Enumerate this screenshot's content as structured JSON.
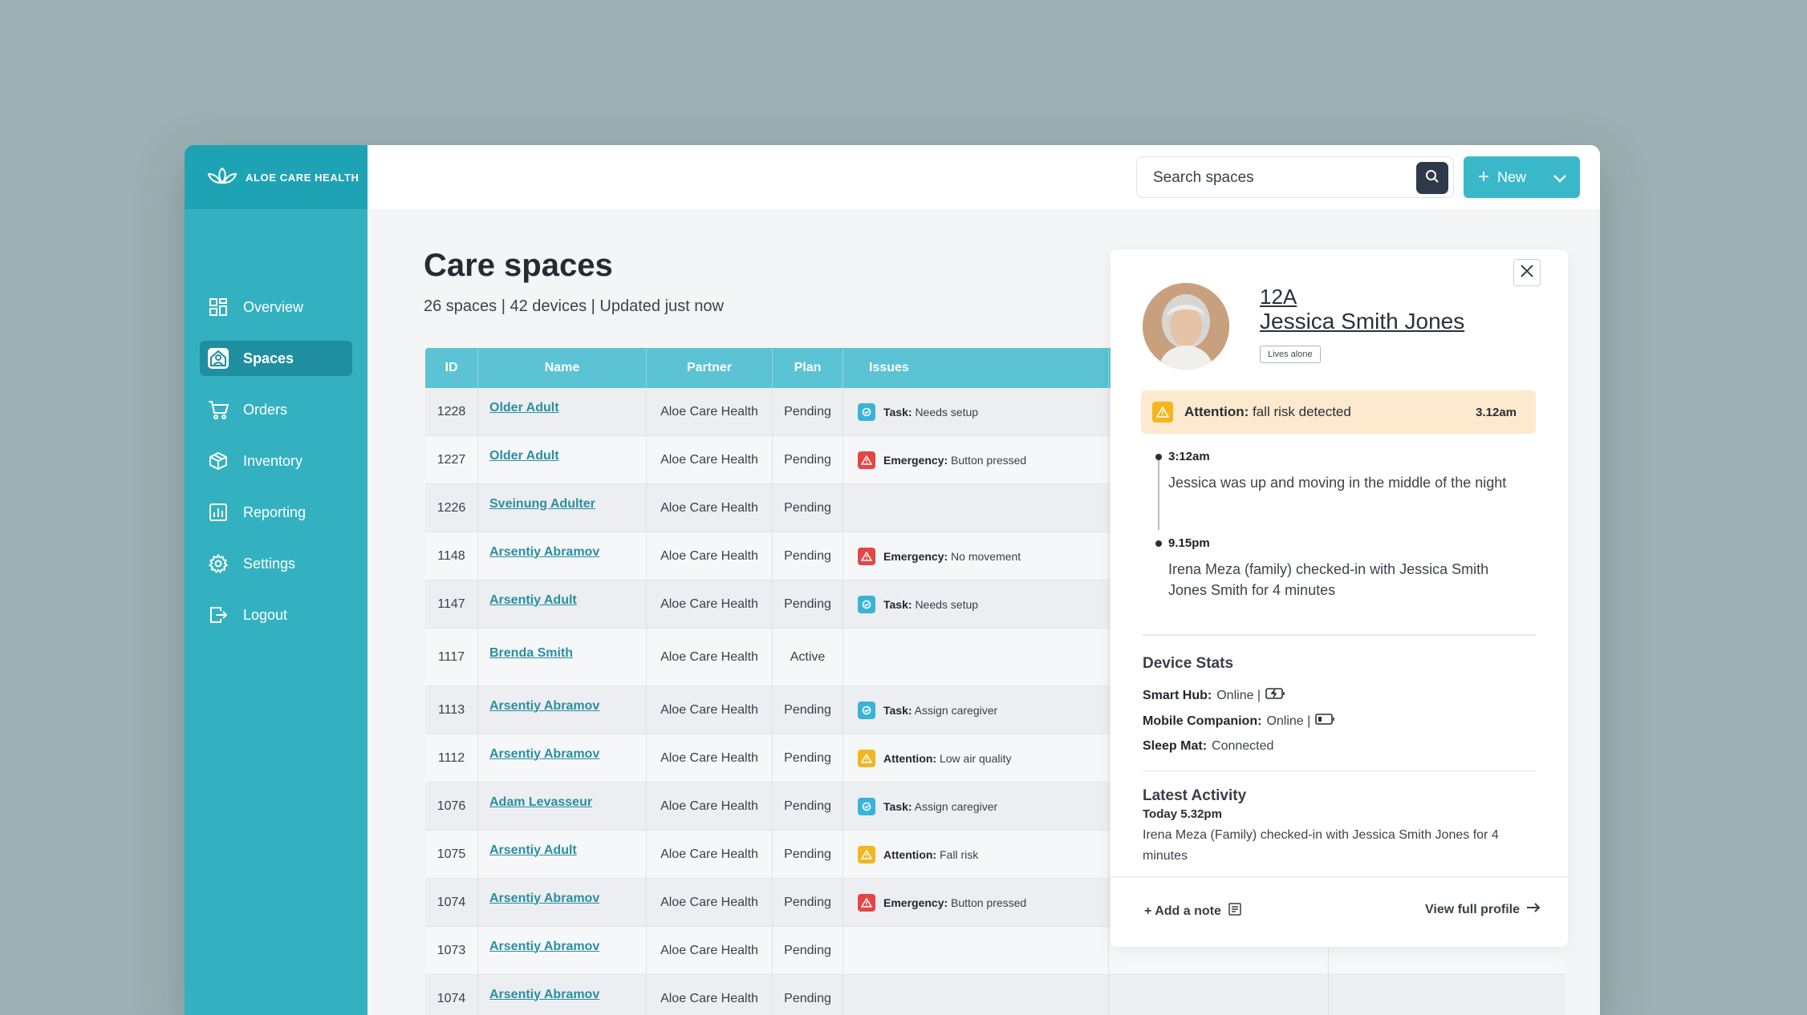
{
  "brand": {
    "name": "ALOE CARE HEALTH"
  },
  "sidebar": {
    "items": [
      {
        "label": "Overview",
        "icon": "grid-icon"
      },
      {
        "label": "Spaces",
        "icon": "home-person-icon"
      },
      {
        "label": "Orders",
        "icon": "cart-icon"
      },
      {
        "label": "Inventory",
        "icon": "box-icon"
      },
      {
        "label": "Reporting",
        "icon": "chart-icon"
      },
      {
        "label": "Settings",
        "icon": "gear-icon"
      },
      {
        "label": "Logout",
        "icon": "logout-icon"
      }
    ]
  },
  "search": {
    "placeholder": "Search spaces"
  },
  "new_button": {
    "label": "New"
  },
  "page": {
    "title": "Care spaces",
    "subtitle": "26 spaces | 42 devices | Updated just now"
  },
  "table": {
    "headers": [
      "ID",
      "Name",
      "Partner",
      "Plan",
      "Issues"
    ],
    "rows": [
      {
        "id": "1228",
        "name": "Older Adult",
        "partner": "Aloe Care Health",
        "plan": "Pending",
        "issue_type": "Task:",
        "issue_text": "Needs setup"
      },
      {
        "id": "1227",
        "name": "Older Adult",
        "partner": "Aloe Care Health",
        "plan": "Pending",
        "issue_type": "Emergency:",
        "issue_text": "Button pressed"
      },
      {
        "id": "1226",
        "name": "Sveinung Adulter",
        "partner": "Aloe Care Health",
        "plan": "Pending",
        "issue_type": "",
        "issue_text": ""
      },
      {
        "id": "1148",
        "name": "Arsentiy Abramov",
        "partner": "Aloe Care Health",
        "plan": "Pending",
        "issue_type": "Emergency:",
        "issue_text": "No movement"
      },
      {
        "id": "1147",
        "name": "Arsentiy Adult",
        "partner": "Aloe Care Health",
        "plan": "Pending",
        "issue_type": "Task:",
        "issue_text": "Needs setup"
      },
      {
        "id": "1117",
        "name": "Brenda Smith",
        "partner": "Aloe Care Health",
        "plan": "Active",
        "issue_type": "",
        "issue_text": ""
      },
      {
        "id": "1113",
        "name": "Arsentiy Abramov",
        "partner": "Aloe Care Health",
        "plan": "Pending",
        "issue_type": "Task:",
        "issue_text": "Assign caregiver"
      },
      {
        "id": "1112",
        "name": "Arsentiy Abramov",
        "partner": "Aloe Care Health",
        "plan": "Pending",
        "issue_type": "Attention:",
        "issue_text": "Low air quality"
      },
      {
        "id": "1076",
        "name": "Adam Levasseur",
        "partner": "Aloe Care Health",
        "plan": "Pending",
        "issue_type": "Task:",
        "issue_text": "Assign caregiver"
      },
      {
        "id": "1075",
        "name": "Arsentiy Adult",
        "partner": "Aloe Care Health",
        "plan": "Pending",
        "issue_type": "Attention:",
        "issue_text": "Fall risk"
      },
      {
        "id": "1074",
        "name": "Arsentiy Abramov",
        "partner": "Aloe Care Health",
        "plan": "Pending",
        "issue_type": "Emergency:",
        "issue_text": "Button pressed"
      },
      {
        "id": "1073",
        "name": "Arsentiy Abramov",
        "partner": "Aloe Care Health",
        "plan": "Pending",
        "issue_type": "",
        "issue_text": ""
      },
      {
        "id": "1074",
        "name": "Arsentiy Abramov",
        "partner": "Aloe Care Health",
        "plan": "Pending",
        "issue_type": "",
        "issue_text": ""
      }
    ]
  },
  "panel": {
    "unit": "12A",
    "name": "Jessica Smith Jones",
    "tag": "Lives alone",
    "alert": {
      "label": "Attention:",
      "text": "fall risk detected",
      "time": "3.12am"
    },
    "timeline": [
      {
        "time": "3:12am",
        "text": "Jessica was up and moving in the middle of the night"
      },
      {
        "time": "9.15pm",
        "text": "Irena Meza (family) checked-in with Jessica Smith Jones Smith for 4 minutes"
      }
    ],
    "device_stats": {
      "title": "Device Stats",
      "smart_hub_label": "Smart Hub:",
      "smart_hub_value": "Online |",
      "mobile_label": "Mobile Companion:",
      "mobile_value": "Online |",
      "sleep_label": "Sleep Mat:",
      "sleep_value": "Connected"
    },
    "latest_activity": {
      "title": "Latest Activity",
      "time": "Today 5.32pm",
      "text": "Irena Meza (Family) checked-in with Jessica Smith Jones for 4 minutes"
    },
    "add_note": "+ Add a note",
    "view_profile": "View full profile"
  },
  "colors": {
    "sidebar": "#33b1c1",
    "accent": "#3ab8ca",
    "task": "#3ab3d8",
    "emergency": "#e64545",
    "attention": "#f3b61f"
  }
}
